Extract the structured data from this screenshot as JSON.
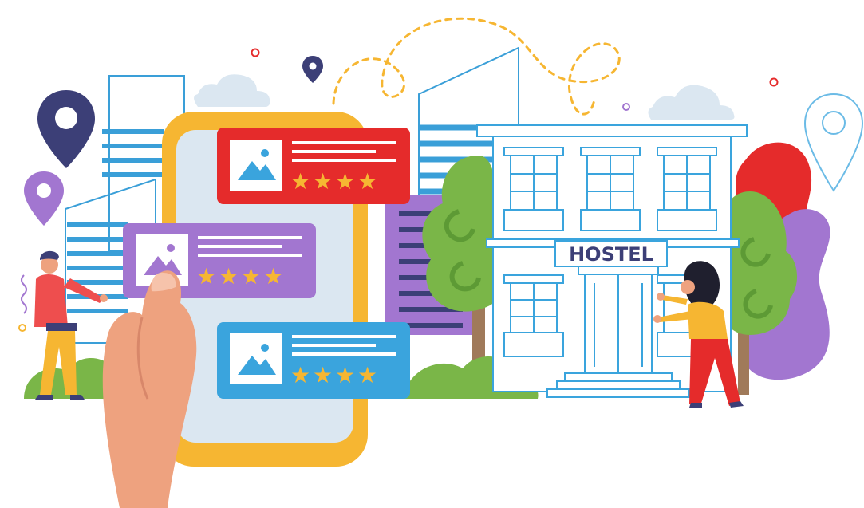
{
  "hostel_sign": {
    "label": "HOSTEL"
  },
  "review_cards": [
    {
      "stars": 4,
      "color": "#e52b2b"
    },
    {
      "stars": 4,
      "color": "#a276d0"
    },
    {
      "stars": 4,
      "color": "#3aa4dd"
    }
  ],
  "colors": {
    "phone_body": "#f6b632",
    "phone_screen": "#dbe7f1",
    "building_line": "#3a9fd8",
    "hostel_line": "#3aa4dd",
    "sign_text": "#3c3f77",
    "star": "#f6b632",
    "tree_green": "#7ab648",
    "skin": "#eea27f",
    "pin_navy": "#3c3f77",
    "pin_purple": "#a276d0",
    "map_trail": "#f6b632"
  }
}
